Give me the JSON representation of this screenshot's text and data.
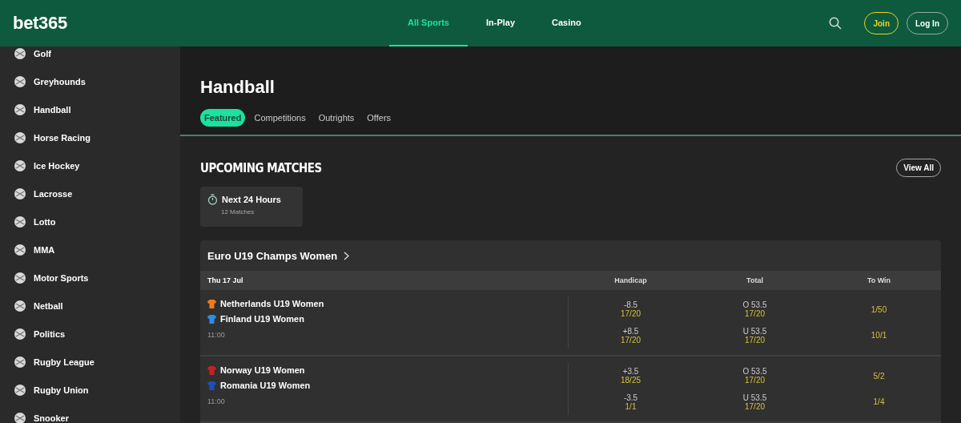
{
  "header": {
    "logo": "bet365",
    "nav": [
      {
        "label": "All Sports",
        "selected": true
      },
      {
        "label": "In-Play",
        "selected": false
      },
      {
        "label": "Casino",
        "selected": false
      }
    ],
    "join": "Join",
    "login": "Log In"
  },
  "sidebar": {
    "items": [
      "Golf",
      "Greyhounds",
      "Handball",
      "Horse Racing",
      "Ice Hockey",
      "Lacrosse",
      "Lotto",
      "MMA",
      "Motor Sports",
      "Netball",
      "Politics",
      "Rugby League",
      "Rugby Union",
      "Snooker"
    ]
  },
  "page": {
    "title": "Handball",
    "tabs": [
      {
        "label": "Featured",
        "selected": true
      },
      {
        "label": "Competitions",
        "selected": false
      },
      {
        "label": "Outrights",
        "selected": false
      },
      {
        "label": "Offers",
        "selected": false
      }
    ]
  },
  "upcoming": {
    "title": "UPCOMING MATCHES",
    "view_all": "View All",
    "filter": {
      "title": "Next 24 Hours",
      "count": "12 Matches"
    }
  },
  "competition": {
    "name": "Euro U19 Champs Women",
    "date": "Thu 17 Jul",
    "columns": [
      "Handicap",
      "Total",
      "To Win"
    ],
    "matches": [
      {
        "time": "11:00",
        "teams": [
          {
            "name": "Netherlands U19 Women",
            "color": "#f07a1a",
            "handicap": "-8.5",
            "handicap_odds": "17/20",
            "total": "O 53.5",
            "total_odds": "17/20",
            "win": "1/50"
          },
          {
            "name": "Finland U19 Women",
            "color": "#2f8de4",
            "handicap": "+8.5",
            "handicap_odds": "17/20",
            "total": "U 53.5",
            "total_odds": "17/20",
            "win": "10/1"
          }
        ]
      },
      {
        "time": "11:00",
        "teams": [
          {
            "name": "Norway U19 Women",
            "color": "#c8202a",
            "handicap": "+3.5",
            "handicap_odds": "18/25",
            "total": "O 53.5",
            "total_odds": "17/20",
            "win": "5/2"
          },
          {
            "name": "Romania U19 Women",
            "color": "#1f4fb8",
            "handicap": "-3.5",
            "handicap_odds": "1/1",
            "total": "U 53.5",
            "total_odds": "17/20",
            "win": "1/4"
          }
        ]
      }
    ]
  }
}
